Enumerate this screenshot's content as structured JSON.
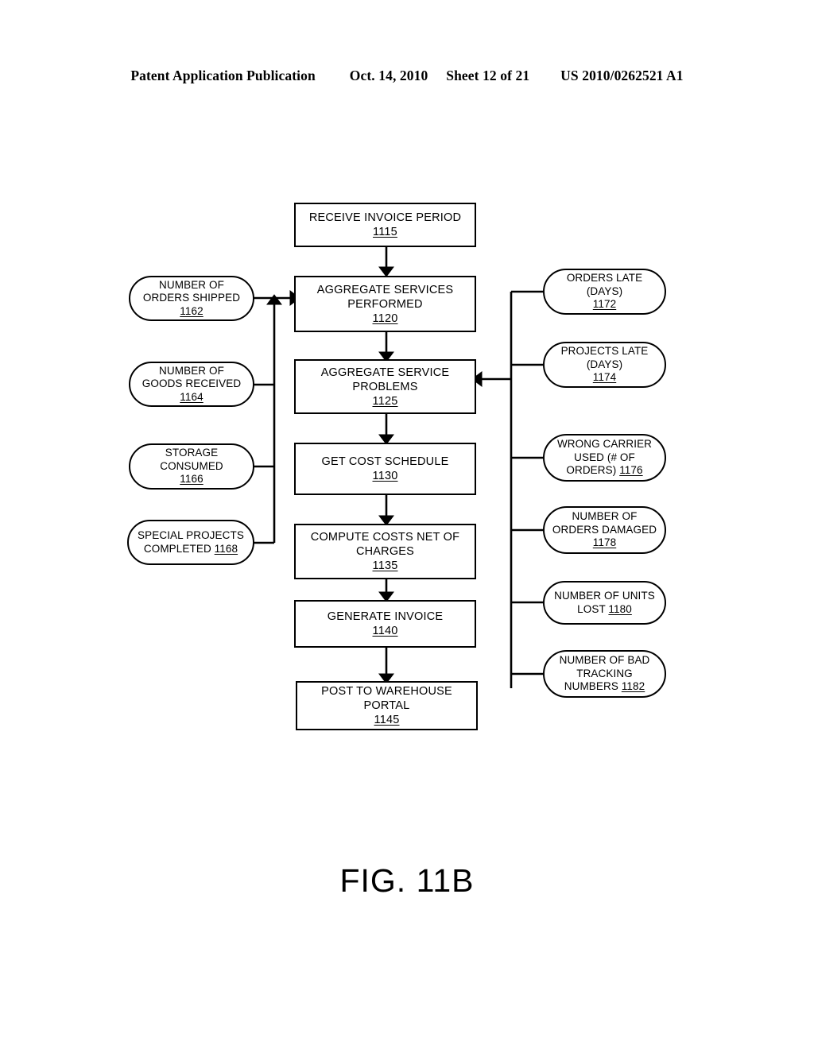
{
  "header": {
    "publication": "Patent Application Publication",
    "date": "Oct. 14, 2010",
    "sheet": "Sheet 12 of 21",
    "patent_number": "US 2010/0262521 A1"
  },
  "figure": {
    "caption": "FIG. 11B"
  },
  "process_flow": [
    {
      "id": "1115",
      "label": "RECEIVE INVOICE PERIOD",
      "ref": "1115"
    },
    {
      "id": "1120",
      "label": "AGGREGATE SERVICES\nPERFORMED",
      "ref": "1120"
    },
    {
      "id": "1125",
      "label": "AGGREGATE SERVICE\nPROBLEMS",
      "ref": "1125"
    },
    {
      "id": "1130",
      "label": "GET COST SCHEDULE",
      "ref": "1130"
    },
    {
      "id": "1135",
      "label": "COMPUTE COSTS NET OF\nCHARGES",
      "ref": "1135"
    },
    {
      "id": "1140",
      "label": "GENERATE INVOICE",
      "ref": "1140"
    },
    {
      "id": "1145",
      "label": "POST TO WAREHOUSE\nPORTAL",
      "ref": "1145"
    }
  ],
  "inputs_left": [
    {
      "id": "1162",
      "label": "NUMBER OF\nORDERS SHIPPED",
      "ref": "1162",
      "ref_inline": false
    },
    {
      "id": "1164",
      "label": "NUMBER OF\nGOODS RECEIVED",
      "ref": "1164",
      "ref_inline": false
    },
    {
      "id": "1166",
      "label": "STORAGE\nCONSUMED",
      "ref": "1166",
      "ref_inline": false
    },
    {
      "id": "1168",
      "label": "SPECIAL PROJECTS\nCOMPLETED ",
      "ref": "1168",
      "ref_inline": true
    }
  ],
  "inputs_right": [
    {
      "id": "1172",
      "label": "ORDERS LATE\n(DAYS)",
      "ref": "1172",
      "ref_inline": false
    },
    {
      "id": "1174",
      "label": "PROJECTS LATE\n(DAYS)",
      "ref": "1174",
      "ref_inline": false
    },
    {
      "id": "1176",
      "label": "WRONG CARRIER\nUSED (# OF\nORDERS) ",
      "ref": "1176",
      "ref_inline": true
    },
    {
      "id": "1178",
      "label": "NUMBER OF\nORDERS DAMAGED",
      "ref": "1178",
      "ref_inline": false
    },
    {
      "id": "1180",
      "label": "NUMBER OF UNITS\nLOST ",
      "ref": "1180",
      "ref_inline": true
    },
    {
      "id": "1182",
      "label": "NUMBER OF BAD\nTRACKING\nNUMBERS ",
      "ref": "1182",
      "ref_inline": true
    }
  ],
  "colors": {
    "ink": "#000000",
    "paper": "#ffffff"
  }
}
